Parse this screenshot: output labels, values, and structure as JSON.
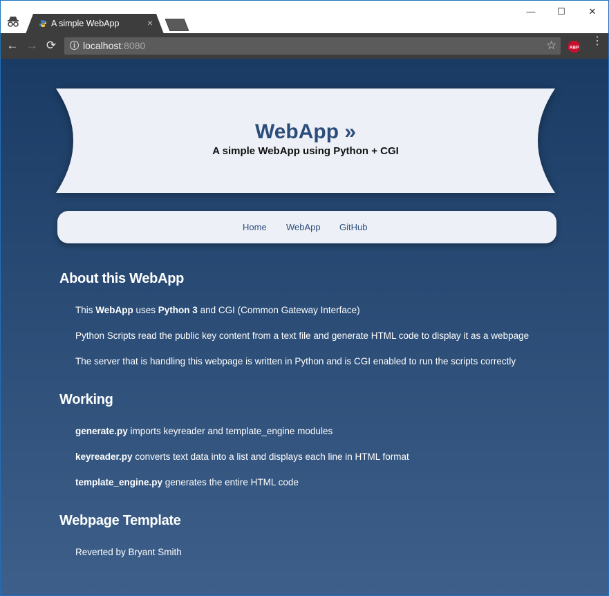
{
  "browser": {
    "tab_title": "A simple WebApp",
    "tab_close": "×",
    "url_host": "localhost",
    "url_port": ":8080",
    "window_controls": {
      "minimize": "—",
      "maximize": "☐",
      "close": "✕"
    },
    "nav": {
      "back": "←",
      "forward": "→",
      "reload": "⟳"
    },
    "info_icon": "i",
    "bookmark_icon": "☆",
    "extension_label": "ABP",
    "menu_icon": "⋮"
  },
  "page": {
    "title": "WebApp »",
    "subtitle": "A simple WebApp using Python + CGI",
    "nav_links": [
      "Home",
      "WebApp",
      "GitHub"
    ],
    "sections": [
      {
        "heading": "About this WebApp",
        "paragraphs": [
          {
            "parts": [
              "This ",
              "WebApp",
              " uses ",
              "Python 3",
              " and ",
              "CGI",
              " (Common Gateway Interface)"
            ]
          },
          {
            "text": "Python Scripts read the public key content from a text file and generate HTML code to display it as a webpage"
          },
          {
            "text": "The server that is handling this webpage is written in Python and is CGI enabled to run the scripts correctly"
          }
        ]
      },
      {
        "heading": "Working",
        "paragraphs": [
          {
            "bold": "generate.py",
            "text": " imports keyreader and template_engine modules"
          },
          {
            "bold": "keyreader.py",
            "text": " converts text data into a list and displays each line in HTML format"
          },
          {
            "bold": "template_engine.py",
            "text": " generates the entire HTML code"
          }
        ]
      },
      {
        "heading": "Webpage Template",
        "paragraphs": [
          {
            "text": "Reverted by Bryant Smith"
          }
        ]
      }
    ]
  },
  "colors": {
    "accent": "#2c4d7a",
    "background_top": "#1a3b64",
    "background_bottom": "#3d5f89",
    "panel": "#edf0f7"
  }
}
